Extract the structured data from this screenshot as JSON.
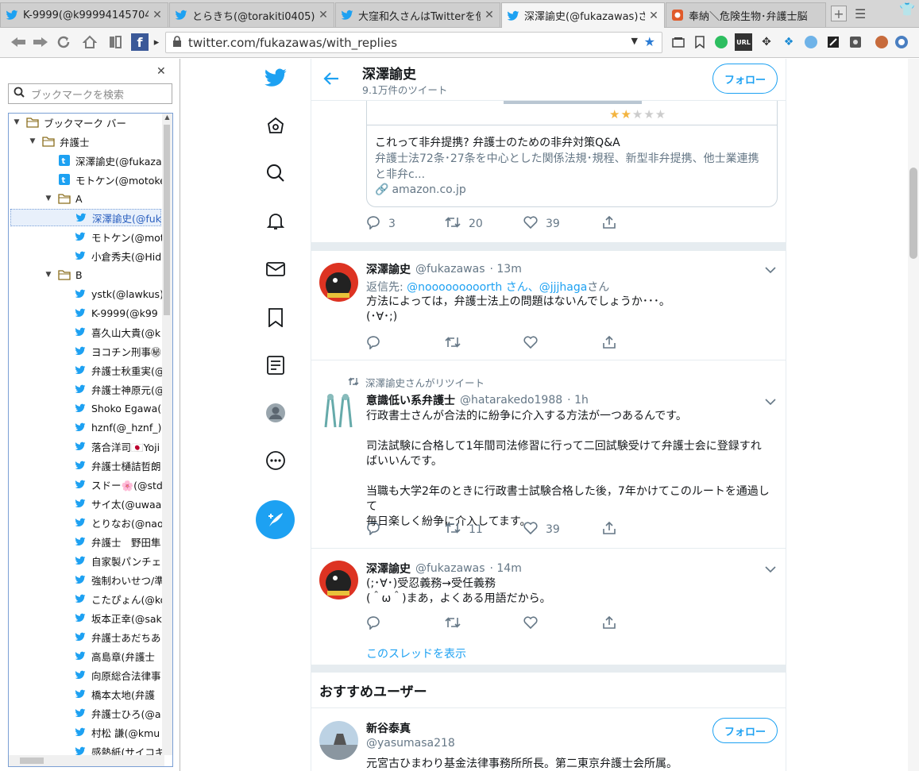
{
  "tabs": [
    {
      "title": "K-9999(@k99994145704",
      "active": false
    },
    {
      "title": "とらきち(@torakiti0405)さ",
      "active": false
    },
    {
      "title": "大窪和久さんはTwitterを使",
      "active": false
    },
    {
      "title": "深澤諭史(@fukazawas)さ",
      "active": true
    },
    {
      "title": "奉納＼危険生物･弁護士脳",
      "active": false
    }
  ],
  "url": "twitter.com/fukazawas/with_replies",
  "sidebar": {
    "search_placeholder": "ブックマークを検索",
    "items": [
      {
        "label": "ブックマーク バー",
        "type": "folder",
        "level": 0
      },
      {
        "label": "弁護士",
        "type": "folder",
        "level": 1
      },
      {
        "label": "深澤諭史(@fukaza",
        "type": "bm",
        "level": 2
      },
      {
        "label": "モトケン(@motoke",
        "type": "bm",
        "level": 2
      },
      {
        "label": "A",
        "type": "folder",
        "level": 2
      },
      {
        "label": "深澤諭史(@fuk",
        "type": "bm",
        "level": 3,
        "selected": true
      },
      {
        "label": "モトケン(@moto",
        "type": "bm",
        "level": 3
      },
      {
        "label": "小倉秀夫(@Hid",
        "type": "bm",
        "level": 3
      },
      {
        "label": "B",
        "type": "folder",
        "level": 2
      },
      {
        "label": "ystk(@lawkus)",
        "type": "bm",
        "level": 3
      },
      {
        "label": "K-9999(@k99",
        "type": "bm",
        "level": 3
      },
      {
        "label": "喜久山大貴(@k",
        "type": "bm",
        "level": 3
      },
      {
        "label": "ヨコチン刑事㊙",
        "type": "bm",
        "level": 3
      },
      {
        "label": "弁護士秋重実(@",
        "type": "bm",
        "level": 3
      },
      {
        "label": "弁護士神原元(@",
        "type": "bm",
        "level": 3
      },
      {
        "label": "Shoko Egawa(@",
        "type": "bm",
        "level": 3
      },
      {
        "label": "hznf(@_hznf_)",
        "type": "bm",
        "level": 3
      },
      {
        "label": "落合洋司🇯🇵Yoji",
        "type": "bm",
        "level": 3
      },
      {
        "label": "弁護士樋詰哲朗",
        "type": "bm",
        "level": 3
      },
      {
        "label": "スドー🌸(@std",
        "type": "bm",
        "level": 3
      },
      {
        "label": "サイ太(@uwaaa",
        "type": "bm",
        "level": 3
      },
      {
        "label": "とりなお(@naot",
        "type": "bm",
        "level": 3
      },
      {
        "label": "弁護士　野田隼",
        "type": "bm",
        "level": 3
      },
      {
        "label": "自家製パンチェ",
        "type": "bm",
        "level": 3
      },
      {
        "label": "強制わいせつ/準",
        "type": "bm",
        "level": 3
      },
      {
        "label": "こたぴょん(@ko",
        "type": "bm",
        "level": 3
      },
      {
        "label": "坂本正幸(@sak",
        "type": "bm",
        "level": 3
      },
      {
        "label": "弁護士あだちあ",
        "type": "bm",
        "level": 3
      },
      {
        "label": "高島章(弁護士",
        "type": "bm",
        "level": 3
      },
      {
        "label": "向原総合法律事",
        "type": "bm",
        "level": 3
      },
      {
        "label": "橋本太地(弁護",
        "type": "bm",
        "level": 3
      },
      {
        "label": "弁護士ひろ(@a",
        "type": "bm",
        "level": 3
      },
      {
        "label": "村松 謙(@kmu",
        "type": "bm",
        "level": 3
      },
      {
        "label": "感熱紙(サイコキ",
        "type": "bm",
        "level": 3
      }
    ]
  },
  "header": {
    "name": "深澤諭史",
    "count": "9.1万件のツイート",
    "follow": "フォロー"
  },
  "card": {
    "title": "これって非弁提携? 弁護士のための非弁対策Q&A",
    "desc1": "弁護士法72条･27条を中心とした関係法規･規程、新型非弁提携、他士業連携",
    "desc2": "と非弁c...",
    "domain": "amazon.co.jp",
    "rating": 2
  },
  "tweet0": {
    "reply": "3",
    "retweet": "20",
    "like": "39"
  },
  "tweet1": {
    "name": "深澤諭史",
    "handle": "@fukazawas",
    "time": "· 13m",
    "reply_prefix": "返信先: ",
    "reply_to": "@nooooooooorth さん、@jjjhaga",
    "reply_suffix": "さん",
    "line1": "方法によっては，弁護士法上の問題はないんでしょうか･･･。",
    "line2": "(･∀･;)"
  },
  "tweet2": {
    "rt_label": "深澤諭史さんがリツイート",
    "name": "意識低い系弁護士",
    "handle": "@hatarakedo1988",
    "time": "· 1h",
    "p1": "行政書士さんが合法的に紛争に介入する方法が一つあるんです。",
    "p2a": "司法試験に合格して1年間司法修習に行って二回試験受けて弁護士会に登録すれ",
    "p2b": "ばいいんです。",
    "p3a": "当職も大学2年のときに行政書士試験合格した後，7年かけてこのルートを通過して",
    "p3b": "毎日楽しく紛争に介入してます。",
    "retweet": "11",
    "like": "39"
  },
  "tweet3": {
    "name": "深澤諭史",
    "handle": "@fukazawas",
    "time": "· 14m",
    "line1": "(;･∀･)受忍義務→受任義務",
    "line2": "(＾ω＾)まあ，よくある用語だから。",
    "thread": "このスレッドを表示"
  },
  "recommend": {
    "title": "おすすめユーザー",
    "name": "新谷泰真",
    "handle": "@yasumasa218",
    "bio": "元宮古ひまわり基金法律事務所所長。第二東京弁護士会所属。",
    "follow": "フォロー"
  }
}
